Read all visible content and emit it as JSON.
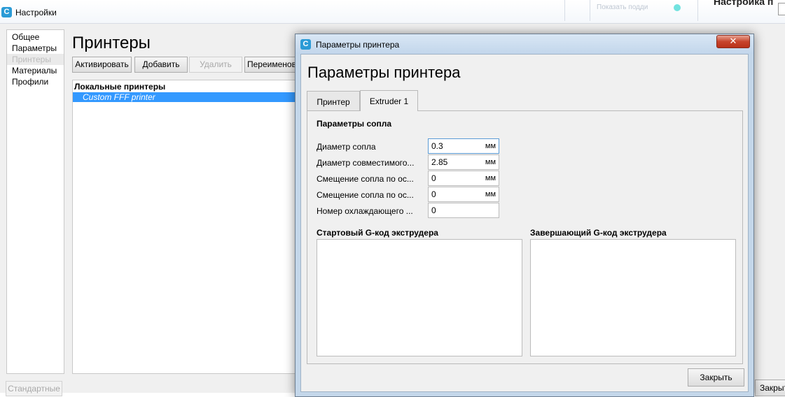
{
  "settings_window": {
    "title": "Настройки",
    "sidebar": {
      "items": [
        {
          "label": "Общее"
        },
        {
          "label": "Параметры"
        },
        {
          "label": "Принтеры"
        },
        {
          "label": "Материалы"
        },
        {
          "label": "Профили"
        }
      ],
      "selected_index": 2
    },
    "page_title": "Принтеры",
    "toolbar": {
      "activate": "Активировать",
      "add": "Добавить",
      "remove": "Удалить",
      "rename": "Переименовать"
    },
    "printer_list": {
      "group_header": "Локальные принтеры",
      "items": [
        "Custom FFF printer"
      ]
    },
    "defaults_button": "Стандартные",
    "close_button": "Закрыть",
    "background_right": {
      "faded_text": "Показать подди",
      "heading": "Настройка п"
    }
  },
  "dialog": {
    "title": "Параметры принтера",
    "heading": "Параметры принтера",
    "tabs": [
      {
        "label": "Принтер",
        "active": false
      },
      {
        "label": "Extruder 1",
        "active": true
      }
    ],
    "nozzle_section": {
      "title": "Параметры сопла",
      "fields": [
        {
          "label": "Диаметр сопла",
          "value": "0.3",
          "unit": "мм"
        },
        {
          "label": "Диаметр совместимого...",
          "value": "2.85",
          "unit": "мм"
        },
        {
          "label": "Смещение сопла по ос...",
          "value": "0",
          "unit": "мм"
        },
        {
          "label": "Смещение сопла по ос...",
          "value": "0",
          "unit": "мм"
        },
        {
          "label": "Номер охлаждающего ...",
          "value": "0",
          "unit": ""
        }
      ]
    },
    "start_gcode": {
      "title": "Стартовый G-код экструдера",
      "value": ""
    },
    "end_gcode": {
      "title": "Завершающий G-код экструдера",
      "value": ""
    },
    "close_button": "Закрыть",
    "colors": {
      "accent": "#3399ff",
      "close_red": "#c7442c",
      "titlebar": "#c2d6eb"
    }
  }
}
